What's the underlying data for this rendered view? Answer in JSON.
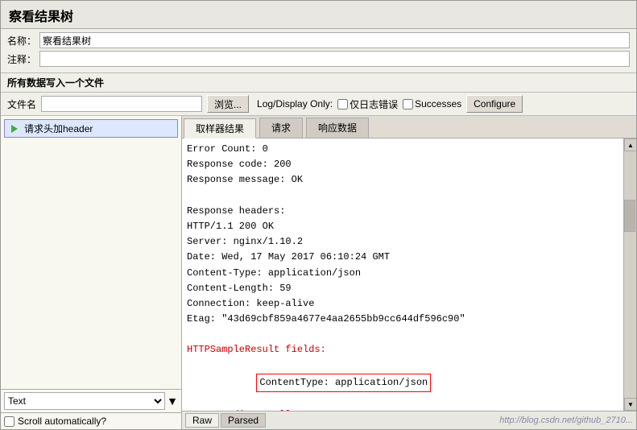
{
  "title": "察看结果树",
  "form": {
    "name_label": "名称：",
    "name_value": "察看结果树",
    "comment_label": "注释：",
    "comment_value": ""
  },
  "file_section": {
    "header": "所有数据写入一个文件",
    "file_label": "文件名",
    "file_value": "",
    "browse_btn": "浏览...",
    "log_display_label": "Log/Display Only:",
    "errors_label": "仅日志错误",
    "successes_label": "Successes",
    "configure_btn": "Configure"
  },
  "tree": {
    "item_label": "请求头加header"
  },
  "tabs": {
    "sampler_result": "取样器结果",
    "request": "请求",
    "response_data": "响应数据"
  },
  "content": {
    "lines": [
      "Error Count: 0",
      "Response code: 200",
      "Response message: OK",
      "",
      "Response headers:",
      "HTTP/1.1 200 OK",
      "Server: nginx/1.10.2",
      "Date: Wed, 17 May 2017 06:10:24 GMT",
      "Content-Type: application/json",
      "Content-Length: 59",
      "Connection: keep-alive",
      "Etag: \"43d69cbf859a4677e4aa2655bb9cc644df596c90\"",
      "",
      "HTTPSampleResult fields:",
      "ContentType: application/json",
      "DataEncoding: null"
    ]
  },
  "bottom": {
    "text_label": "Text",
    "scroll_label": "Scroll automatically?",
    "raw_tab": "Raw",
    "parsed_tab": "Parsed",
    "watermark": "http://blog.csdn.net/github_2710..."
  }
}
